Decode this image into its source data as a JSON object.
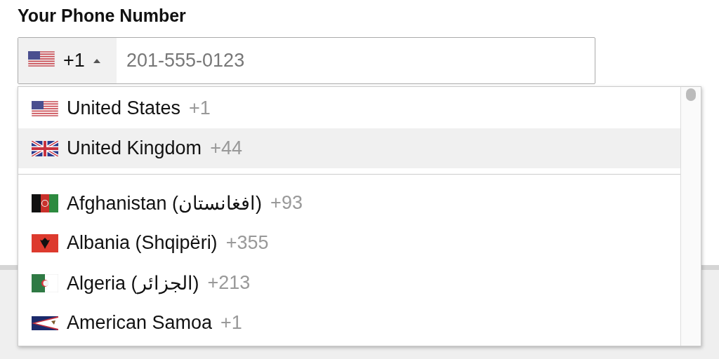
{
  "label": "Your Phone Number",
  "phone_input": {
    "dial_code": "+1",
    "placeholder": "201-555-0123",
    "expanded": true
  },
  "dropdown": {
    "preferred": [
      {
        "name": "United States",
        "dial_code": "+1",
        "highlighted": false
      },
      {
        "name": "United Kingdom",
        "dial_code": "+44",
        "highlighted": true
      }
    ],
    "countries": [
      {
        "name": "Afghanistan (افغانستان)",
        "dial_code": "+93",
        "highlighted": false
      },
      {
        "name": "Albania (Shqipëri)",
        "dial_code": "+355",
        "highlighted": false
      },
      {
        "name": "Algeria (الجزائر)",
        "dial_code": "+213",
        "highlighted": false
      },
      {
        "name": "American Samoa",
        "dial_code": "+1",
        "highlighted": false
      }
    ]
  }
}
